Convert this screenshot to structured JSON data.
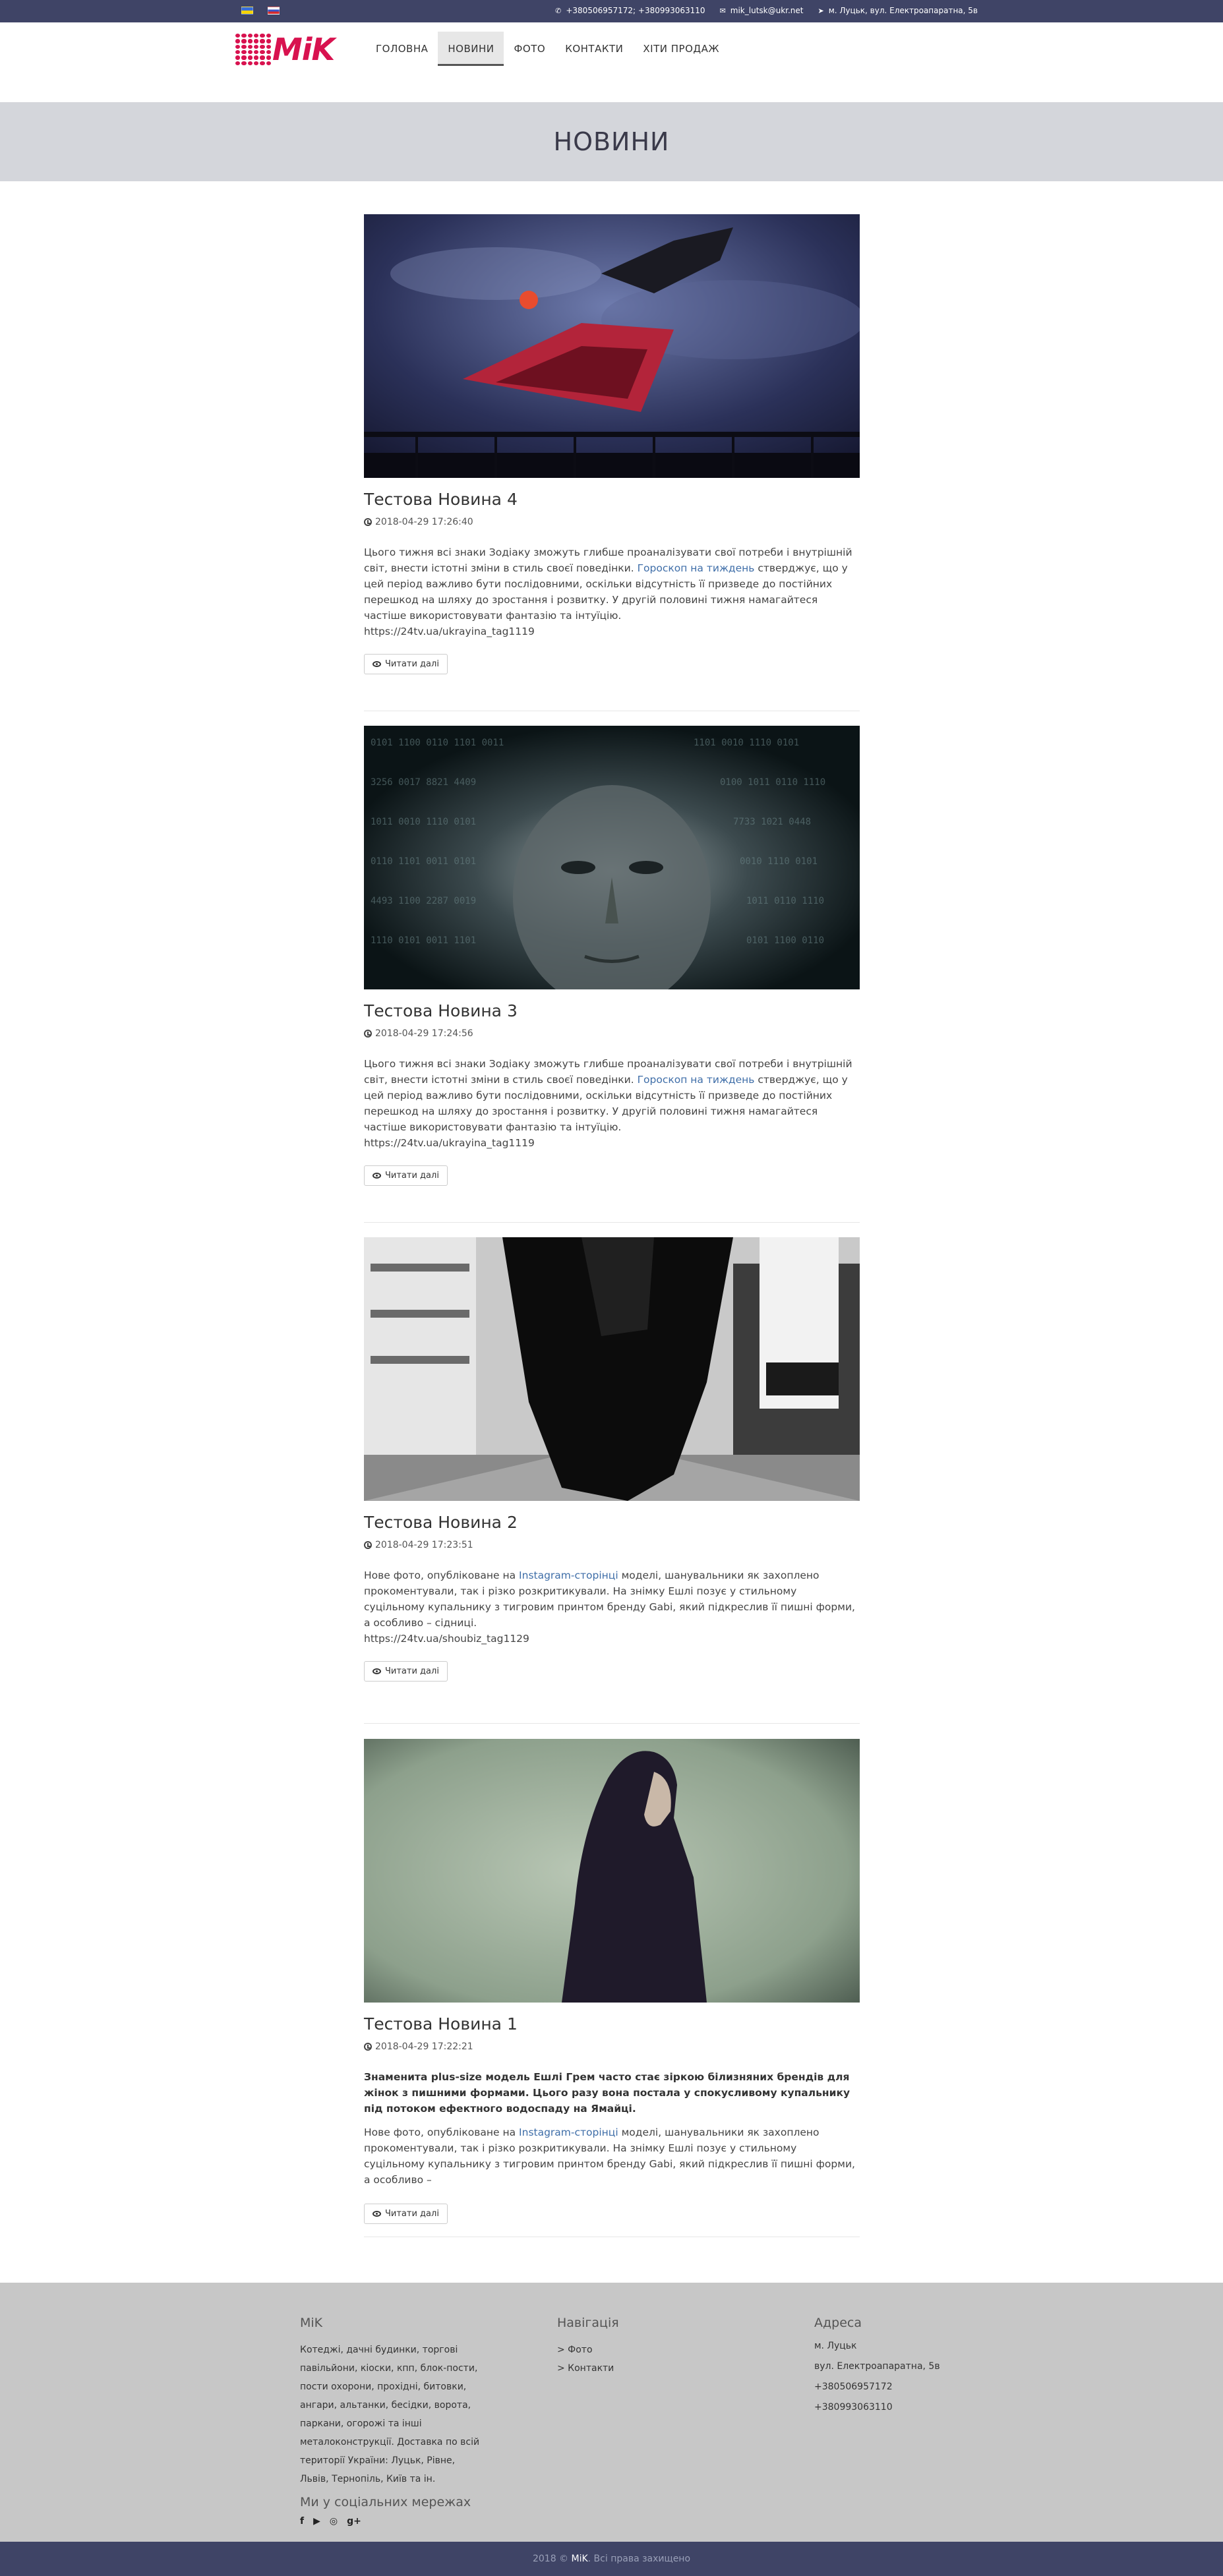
{
  "topbar": {
    "phone": "+380506957172; +380993063110",
    "email": "mik_lutsk@ukr.net",
    "address": "м. Луцьк, вул. Електроапаратна, 5в"
  },
  "logo": {
    "text": "MiK"
  },
  "nav": {
    "items": [
      {
        "label": "ГОЛОВНА"
      },
      {
        "label": "НОВИНИ",
        "active": true
      },
      {
        "label": "ФОТО"
      },
      {
        "label": "КОНТАКТИ"
      },
      {
        "label": "ХІТИ ПРОДАЖ"
      }
    ]
  },
  "page": {
    "title": "НОВИНИ"
  },
  "articles": [
    {
      "title": "Тестова Новина 4",
      "date": "2018-04-29 17:26:40",
      "text_before": "Цього тижня всі знаки Зодіаку зможуть глибше проаналізувати свої потреби і внутрішній світ, внести істотні зміни в стиль своєї поведінки. ",
      "link": "Гороскоп на тиждень",
      "text_after": " стверджує, що у цей період важливо бути послідовними, оскільки відсутність її призведе до постійних перешкод на шляху до зростання і розвитку. У другій половині тижня намагайтеся частіше використовувати фантазію та інтуїцію.",
      "url": "https://24tv.ua/ukrayina_tag1119",
      "button": "Читати далі"
    },
    {
      "title": "Тестова Новина 3",
      "date": "2018-04-29 17:24:56",
      "text_before": "Цього тижня всі знаки Зодіаку зможуть глибше проаналізувати свої потреби і внутрішній світ, внести істотні зміни в стиль своєї поведінки. ",
      "link": "Гороскоп на тиждень",
      "text_after": " стверджує, що у цей період важливо бути послідовними, оскільки відсутність її призведе до постійних перешкод на шляху до зростання і розвитку. У другій половині тижня намагайтеся частіше використовувати фантазію та інтуїцію.",
      "url": "https://24tv.ua/ukrayina_tag1119",
      "button": "Читати далі"
    },
    {
      "title": "Тестова Новина 2",
      "date": "2018-04-29 17:23:51",
      "text_before": "Нове фото, опубліковане на ",
      "link": "Instagram-сторінці",
      "text_after": " моделі, шанувальники як захоплено прокоментували, так і різко розкритикували. На знімку Ешлі позує у стильному суцільному купальнику з тигровим принтом бренду Gabi, який підкреслив її пишні форми, а особливо – сідниці.",
      "url": "https://24tv.ua/shoubiz_tag1129",
      "button": "Читати далі"
    },
    {
      "title": "Тестова Новина 1",
      "date": "2018-04-29 17:22:21",
      "lead": "Знаменита plus-size модель Ешлі Грем часто стає зіркою білизняних брендів для жінок з пишними формами. Цього разу вона постала у спокусливому купальнику під потоком ефектного водоспаду на Ямайці.",
      "text_before": "Нове фото, опубліковане на ",
      "link": "Instagram-сторінці",
      "text_after": " моделі, шанувальники як захоплено прокоментували, так і різко розкритикували. На знімку Ешлі позує у стильному суцільному купальнику з тигровим принтом бренду Gabi, який підкреслив її пишні форми, а особливо –",
      "button": "Читати далі"
    }
  ],
  "footer": {
    "about_title": "MiK",
    "about_text": "Котеджі, дачні будинки, торгові павільйони, кіоски, кпп, блок-пости, пости охорони, прохідні, битовки, ангари, альтанки, бесідки, ворота, паркани, огорожі та інші металоконструкції. Доставка по всій території України: Луцьк, Рівне, Львів, Тернопіль, Київ та ін.",
    "social_title": "Ми у соціальних мережах",
    "social_icons": [
      "f",
      "▶",
      "◎",
      "g+"
    ],
    "nav_title": "Навігація",
    "nav_links": [
      "> Фото",
      "> Контакти"
    ],
    "address_title": "Адреса",
    "address_lines": [
      "м. Луцьк",
      "вул. Електроапаратна, 5в",
      "+380506957172",
      "+380993063110"
    ]
  },
  "copyright": {
    "prefix": "2018 © ",
    "brand": "MiK",
    "suffix": ". Всі права захищено"
  },
  "colors": {
    "brand": "#d8124f",
    "topbar": "#3f4466",
    "header_band": "#d4d6db",
    "footer": "#c7c7c7"
  }
}
